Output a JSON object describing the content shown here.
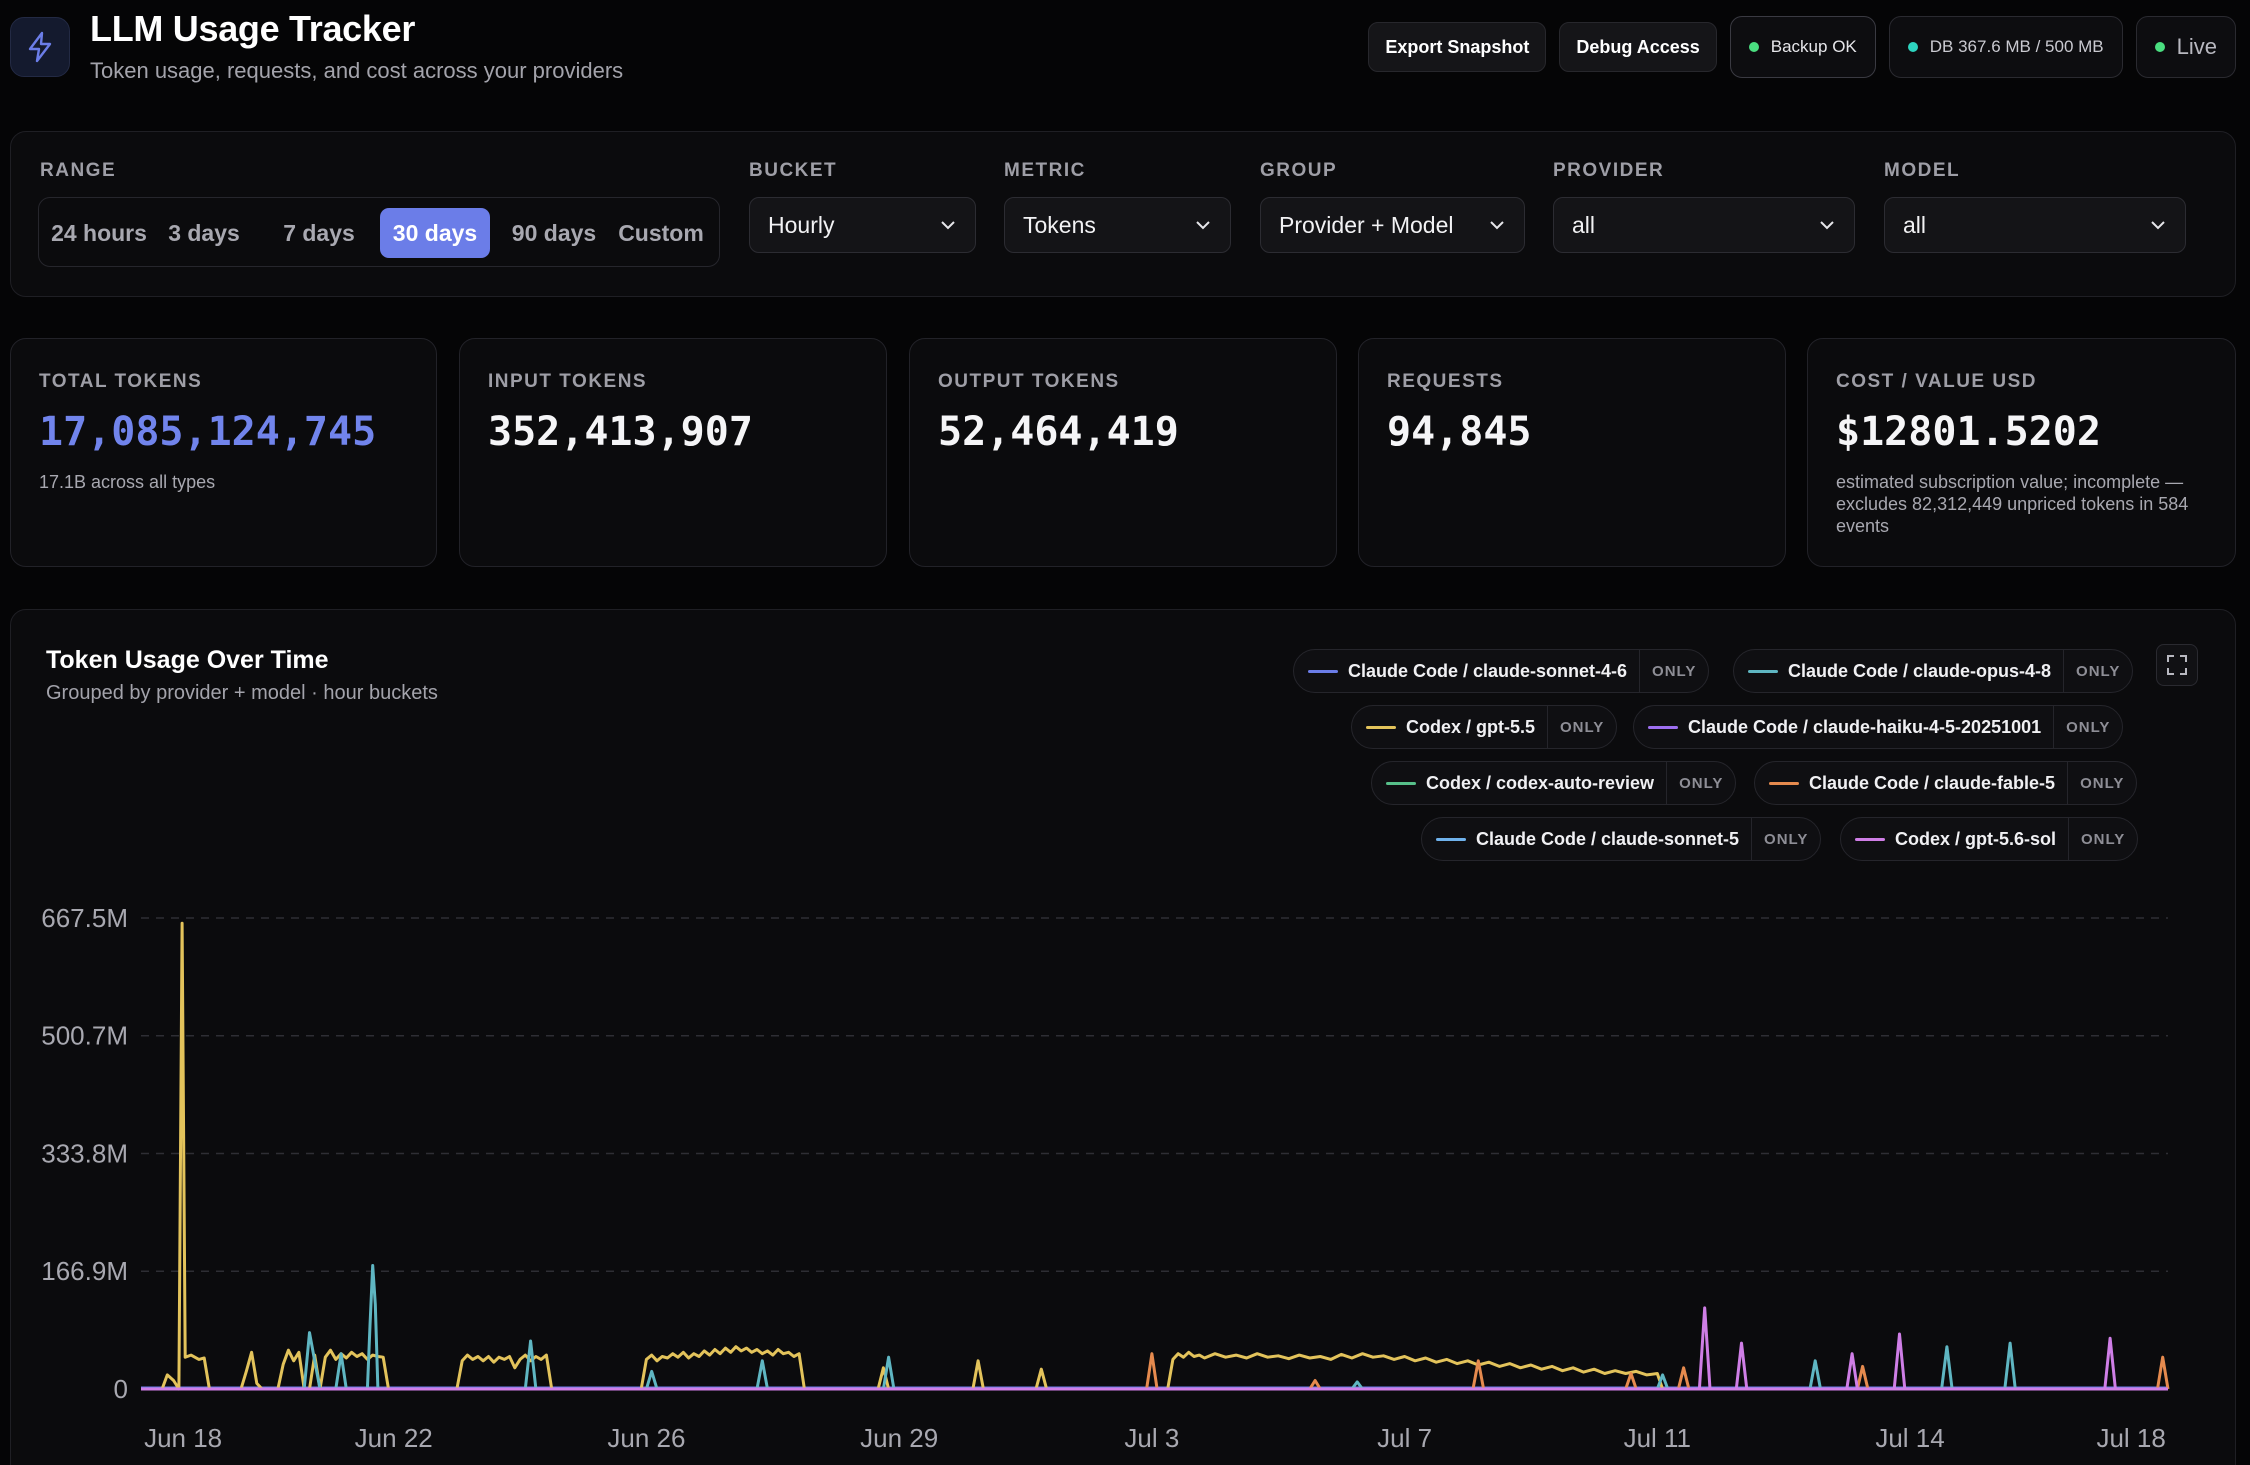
{
  "header": {
    "title": "LLM Usage Tracker",
    "subtitle": "Token usage, requests, and cost across your providers",
    "export_label": "Export Snapshot",
    "debug_label": "Debug Access",
    "backup_label": "Backup OK",
    "db_label": "DB 367.6 MB / 500 MB",
    "live_label": "Live",
    "logo_icon": "bolt-icon"
  },
  "filters": {
    "range_label": "RANGE",
    "range_options": [
      "24 hours",
      "3 days",
      "7 days",
      "30 days",
      "90 days",
      "Custom"
    ],
    "range_selected": "30 days",
    "bucket_label": "BUCKET",
    "bucket_value": "Hourly",
    "metric_label": "METRIC",
    "metric_value": "Tokens",
    "group_label": "GROUP",
    "group_value": "Provider + Model",
    "provider_label": "PROVIDER",
    "provider_value": "all",
    "model_label": "MODEL",
    "model_value": "all"
  },
  "stats": [
    {
      "label": "TOTAL TOKENS",
      "value": "17,085,124,745",
      "note": "17.1B across all types"
    },
    {
      "label": "INPUT TOKENS",
      "value": "352,413,907",
      "note": ""
    },
    {
      "label": "OUTPUT TOKENS",
      "value": "52,464,419",
      "note": ""
    },
    {
      "label": "REQUESTS",
      "value": "94,845",
      "note": ""
    },
    {
      "label": "COST / VALUE USD",
      "value": "$12801.5202",
      "note": "estimated subscription value; incomplete — excludes 82,312,449 unpriced tokens in 584 events"
    }
  ],
  "colors": {
    "accent": "#6b7de8",
    "status_green": "#4ade80",
    "status_teal": "#2dd4bf",
    "grid": "#2a2a30",
    "axis_text": "#a8a8b0"
  },
  "chart": {
    "title": "Token Usage Over Time",
    "subtitle": "Grouped by provider + model · hour buckets",
    "only_label": "ONLY",
    "legend": [
      {
        "name": "Claude Code / claude-sonnet-4-6",
        "color": "#6b7de8"
      },
      {
        "name": "Claude Code / claude-opus-4-8",
        "color": "#5fb6c2"
      },
      {
        "name": "Codex / gpt-5.5",
        "color": "#e3c35b"
      },
      {
        "name": "Claude Code / claude-haiku-4-5-20251001",
        "color": "#9d6ff0"
      },
      {
        "name": "Codex / codex-auto-review",
        "color": "#57c08a"
      },
      {
        "name": "Claude Code / claude-fable-5",
        "color": "#e58a4e"
      },
      {
        "name": "Claude Code / claude-sonnet-5",
        "color": "#6fb2ec"
      },
      {
        "name": "Codex / gpt-5.6-sol",
        "color": "#cf7ee6"
      }
    ]
  },
  "chart_data": {
    "type": "line",
    "title": "Token Usage Over Time",
    "subtitle": "Grouped by provider + model · hour buckets",
    "x_ticks": [
      "Jun 18",
      "Jun 22",
      "Jun 26",
      "Jun 29",
      "Jul 3",
      "Jul 7",
      "Jul 11",
      "Jul 14",
      "Jul 18"
    ],
    "y_ticks": [
      "667.5M",
      "500.7M",
      "333.8M",
      "166.9M",
      "0"
    ],
    "y_tick_values": [
      667.5,
      500.7,
      333.8,
      166.9,
      0
    ],
    "y_unit": "M tokens",
    "x_unit": "days since start of range",
    "x_tick_positions": [
      0.6,
      4.6,
      9.4,
      14.2,
      19.0,
      23.8,
      28.6,
      33.4,
      37.6
    ],
    "xlim": [
      -0.2,
      38.3
    ],
    "ylim": [
      0,
      667.5
    ],
    "grid": true,
    "legend_position": "top-right",
    "series": [
      {
        "name": "Codex / gpt-5.5",
        "color": "#e3c35b",
        "points": [
          [
            -0.2,
            0
          ],
          [
            0.2,
            0
          ],
          [
            0.3,
            20
          ],
          [
            0.42,
            12
          ],
          [
            0.52,
            0
          ],
          [
            0.58,
            660
          ],
          [
            0.64,
            45
          ],
          [
            0.75,
            48
          ],
          [
            0.9,
            42
          ],
          [
            1.0,
            44
          ],
          [
            1.1,
            0
          ],
          [
            1.7,
            0
          ],
          [
            1.8,
            25
          ],
          [
            1.9,
            52
          ],
          [
            2.0,
            8
          ],
          [
            2.1,
            0
          ],
          [
            2.4,
            0
          ],
          [
            2.5,
            35
          ],
          [
            2.6,
            55
          ],
          [
            2.7,
            40
          ],
          [
            2.8,
            52
          ],
          [
            2.9,
            0
          ],
          [
            3.0,
            0
          ],
          [
            3.1,
            48
          ],
          [
            3.2,
            0
          ],
          [
            3.3,
            45
          ],
          [
            3.4,
            55
          ],
          [
            3.5,
            42
          ],
          [
            3.6,
            50
          ],
          [
            3.7,
            44
          ],
          [
            3.8,
            52
          ],
          [
            3.9,
            46
          ],
          [
            4.0,
            50
          ],
          [
            4.1,
            42
          ],
          [
            4.2,
            48
          ],
          [
            4.3,
            46
          ],
          [
            4.4,
            45
          ],
          [
            4.5,
            0
          ],
          [
            5.8,
            0
          ],
          [
            5.9,
            40
          ],
          [
            6.0,
            48
          ],
          [
            6.1,
            42
          ],
          [
            6.2,
            46
          ],
          [
            6.3,
            40
          ],
          [
            6.4,
            46
          ],
          [
            6.5,
            38
          ],
          [
            6.6,
            45
          ],
          [
            6.7,
            42
          ],
          [
            6.8,
            46
          ],
          [
            6.9,
            30
          ],
          [
            7.0,
            42
          ],
          [
            7.1,
            48
          ],
          [
            7.2,
            40
          ],
          [
            7.3,
            46
          ],
          [
            7.4,
            42
          ],
          [
            7.5,
            48
          ],
          [
            7.6,
            0
          ],
          [
            9.3,
            0
          ],
          [
            9.4,
            42
          ],
          [
            9.5,
            48
          ],
          [
            9.6,
            40
          ],
          [
            9.7,
            46
          ],
          [
            9.8,
            44
          ],
          [
            9.9,
            50
          ],
          [
            10.0,
            45
          ],
          [
            10.1,
            52
          ],
          [
            10.2,
            44
          ],
          [
            10.3,
            50
          ],
          [
            10.4,
            46
          ],
          [
            10.5,
            54
          ],
          [
            10.6,
            48
          ],
          [
            10.7,
            56
          ],
          [
            10.8,
            50
          ],
          [
            10.9,
            58
          ],
          [
            11.0,
            52
          ],
          [
            11.1,
            60
          ],
          [
            11.2,
            54
          ],
          [
            11.3,
            58
          ],
          [
            11.4,
            52
          ],
          [
            11.5,
            56
          ],
          [
            11.6,
            50
          ],
          [
            11.7,
            54
          ],
          [
            11.8,
            48
          ],
          [
            11.9,
            56
          ],
          [
            12.0,
            50
          ],
          [
            12.1,
            52
          ],
          [
            12.2,
            46
          ],
          [
            12.3,
            50
          ],
          [
            12.4,
            0
          ],
          [
            13.8,
            0
          ],
          [
            13.9,
            30
          ],
          [
            14.0,
            0
          ],
          [
            15.6,
            0
          ],
          [
            15.7,
            40
          ],
          [
            15.8,
            0
          ],
          [
            16.8,
            0
          ],
          [
            16.9,
            28
          ],
          [
            17.0,
            0
          ],
          [
            19.3,
            0
          ],
          [
            19.4,
            42
          ],
          [
            19.5,
            50
          ],
          [
            19.6,
            45
          ],
          [
            19.7,
            52
          ],
          [
            19.8,
            46
          ],
          [
            19.9,
            48
          ],
          [
            20.0,
            44
          ],
          [
            20.2,
            50
          ],
          [
            20.4,
            45
          ],
          [
            20.6,
            48
          ],
          [
            20.8,
            44
          ],
          [
            21.0,
            50
          ],
          [
            21.2,
            45
          ],
          [
            21.4,
            47
          ],
          [
            21.6,
            43
          ],
          [
            21.8,
            48
          ],
          [
            22.0,
            44
          ],
          [
            22.2,
            46
          ],
          [
            22.4,
            42
          ],
          [
            22.6,
            49
          ],
          [
            22.8,
            44
          ],
          [
            23.0,
            50
          ],
          [
            23.2,
            45
          ],
          [
            23.4,
            47
          ],
          [
            23.6,
            42
          ],
          [
            23.8,
            46
          ],
          [
            24.0,
            40
          ],
          [
            24.2,
            44
          ],
          [
            24.4,
            38
          ],
          [
            24.6,
            42
          ],
          [
            24.8,
            36
          ],
          [
            25.0,
            40
          ],
          [
            25.2,
            34
          ],
          [
            25.4,
            38
          ],
          [
            25.6,
            32
          ],
          [
            25.8,
            36
          ],
          [
            26.0,
            30
          ],
          [
            26.2,
            34
          ],
          [
            26.4,
            28
          ],
          [
            26.6,
            32
          ],
          [
            26.8,
            26
          ],
          [
            27.0,
            30
          ],
          [
            27.2,
            24
          ],
          [
            27.4,
            28
          ],
          [
            27.6,
            22
          ],
          [
            27.8,
            26
          ],
          [
            28.0,
            22
          ],
          [
            28.2,
            25
          ],
          [
            28.4,
            20
          ],
          [
            28.6,
            22
          ],
          [
            28.7,
            0
          ],
          [
            38.3,
            0
          ]
        ]
      },
      {
        "name": "Claude Code / claude-opus-4-8",
        "color": "#5fb6c2",
        "points": [
          [
            -0.2,
            0
          ],
          [
            2.9,
            0
          ],
          [
            3.0,
            80
          ],
          [
            3.1,
            40
          ],
          [
            3.2,
            0
          ],
          [
            3.5,
            0
          ],
          [
            3.6,
            50
          ],
          [
            3.7,
            0
          ],
          [
            4.1,
            0
          ],
          [
            4.15,
            90
          ],
          [
            4.2,
            175
          ],
          [
            4.25,
            120
          ],
          [
            4.3,
            0
          ],
          [
            7.1,
            0
          ],
          [
            7.2,
            68
          ],
          [
            7.3,
            0
          ],
          [
            9.4,
            0
          ],
          [
            9.5,
            25
          ],
          [
            9.6,
            0
          ],
          [
            11.5,
            0
          ],
          [
            11.6,
            40
          ],
          [
            11.7,
            0
          ],
          [
            13.9,
            0
          ],
          [
            14.0,
            45
          ],
          [
            14.1,
            0
          ],
          [
            22.8,
            0
          ],
          [
            22.9,
            10
          ],
          [
            23.0,
            0
          ],
          [
            28.6,
            0
          ],
          [
            28.7,
            20
          ],
          [
            28.8,
            0
          ],
          [
            31.5,
            0
          ],
          [
            31.6,
            40
          ],
          [
            31.7,
            0
          ],
          [
            34.0,
            0
          ],
          [
            34.1,
            60
          ],
          [
            34.2,
            0
          ],
          [
            35.2,
            0
          ],
          [
            35.3,
            65
          ],
          [
            35.4,
            0
          ],
          [
            38.3,
            0
          ]
        ]
      },
      {
        "name": "Claude Code / claude-fable-5",
        "color": "#e58a4e",
        "points": [
          [
            -0.2,
            0
          ],
          [
            18.9,
            0
          ],
          [
            19.0,
            50
          ],
          [
            19.1,
            0
          ],
          [
            22.0,
            0
          ],
          [
            22.1,
            12
          ],
          [
            22.2,
            0
          ],
          [
            25.1,
            0
          ],
          [
            25.2,
            40
          ],
          [
            25.3,
            0
          ],
          [
            28.0,
            0
          ],
          [
            28.1,
            22
          ],
          [
            28.2,
            0
          ],
          [
            29.0,
            0
          ],
          [
            29.1,
            30
          ],
          [
            29.2,
            0
          ],
          [
            32.4,
            0
          ],
          [
            32.5,
            32
          ],
          [
            32.6,
            0
          ],
          [
            38.1,
            0
          ],
          [
            38.2,
            45
          ],
          [
            38.3,
            0
          ]
        ]
      },
      {
        "name": "Codex / gpt-5.6-sol",
        "color": "#cf7ee6",
        "points": [
          [
            -0.2,
            0
          ],
          [
            29.4,
            0
          ],
          [
            29.5,
            115
          ],
          [
            29.6,
            0
          ],
          [
            30.1,
            0
          ],
          [
            30.2,
            65
          ],
          [
            30.3,
            0
          ],
          [
            32.2,
            0
          ],
          [
            32.3,
            50
          ],
          [
            32.4,
            0
          ],
          [
            33.1,
            0
          ],
          [
            33.2,
            78
          ],
          [
            33.3,
            0
          ],
          [
            37.1,
            0
          ],
          [
            37.2,
            72
          ],
          [
            37.3,
            0
          ],
          [
            38.3,
            0
          ]
        ]
      }
    ]
  }
}
